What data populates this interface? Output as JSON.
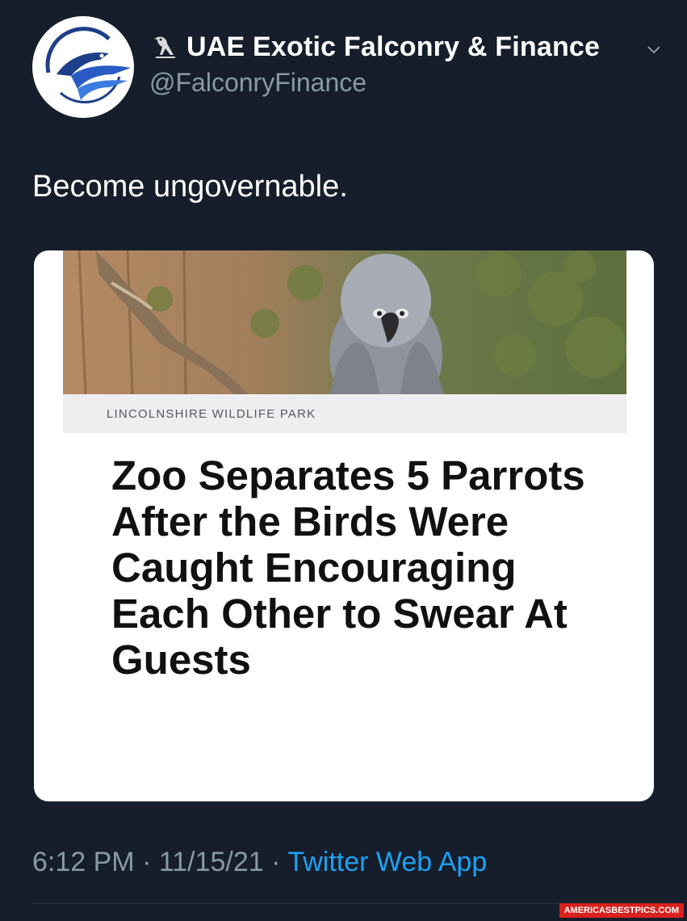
{
  "tweet": {
    "display_name": "UAE Exotic Falconry & Finance",
    "handle": "@FalconryFinance",
    "text": "Become ungovernable.",
    "timestamp": "6:12 PM",
    "date": "11/15/21",
    "separator": "·",
    "source_app": "Twitter Web App"
  },
  "card": {
    "source": "LINCOLNSHIRE WILDLIFE PARK",
    "headline": "Zoo Separates 5 Parrots After the Birds Were Caught Encouraging Each Other to Swear At Guests"
  },
  "icons": {
    "avatar": "falcon-logo",
    "name_emoji": "bird-hieroglyph-icon",
    "menu": "chevron-down-icon"
  },
  "watermark": "AMERICASBESTPICS.COM",
  "colors": {
    "background": "#161d2b",
    "secondary_text": "#8899a6",
    "link": "#1da1f2"
  }
}
